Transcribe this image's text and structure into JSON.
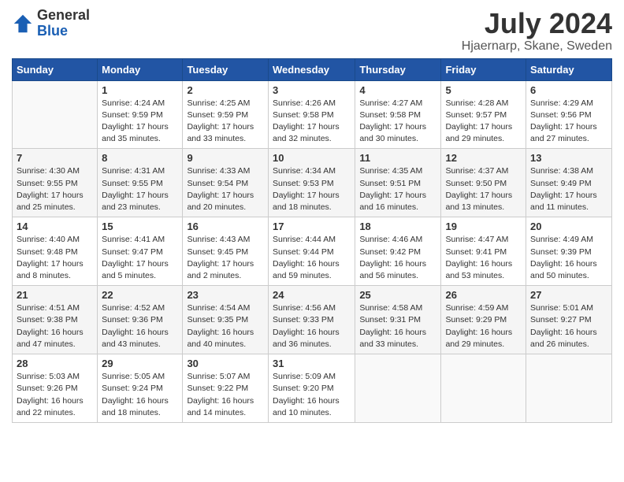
{
  "header": {
    "logo_line1": "General",
    "logo_line2": "Blue",
    "month": "July 2024",
    "location": "Hjaernarp, Skane, Sweden"
  },
  "days_of_week": [
    "Sunday",
    "Monday",
    "Tuesday",
    "Wednesday",
    "Thursday",
    "Friday",
    "Saturday"
  ],
  "weeks": [
    [
      {
        "day": "",
        "info": ""
      },
      {
        "day": "1",
        "info": "Sunrise: 4:24 AM\nSunset: 9:59 PM\nDaylight: 17 hours and 35 minutes."
      },
      {
        "day": "2",
        "info": "Sunrise: 4:25 AM\nSunset: 9:59 PM\nDaylight: 17 hours and 33 minutes."
      },
      {
        "day": "3",
        "info": "Sunrise: 4:26 AM\nSunset: 9:58 PM\nDaylight: 17 hours and 32 minutes."
      },
      {
        "day": "4",
        "info": "Sunrise: 4:27 AM\nSunset: 9:58 PM\nDaylight: 17 hours and 30 minutes."
      },
      {
        "day": "5",
        "info": "Sunrise: 4:28 AM\nSunset: 9:57 PM\nDaylight: 17 hours and 29 minutes."
      },
      {
        "day": "6",
        "info": "Sunrise: 4:29 AM\nSunset: 9:56 PM\nDaylight: 17 hours and 27 minutes."
      }
    ],
    [
      {
        "day": "7",
        "info": "Sunrise: 4:30 AM\nSunset: 9:55 PM\nDaylight: 17 hours and 25 minutes."
      },
      {
        "day": "8",
        "info": "Sunrise: 4:31 AM\nSunset: 9:55 PM\nDaylight: 17 hours and 23 minutes."
      },
      {
        "day": "9",
        "info": "Sunrise: 4:33 AM\nSunset: 9:54 PM\nDaylight: 17 hours and 20 minutes."
      },
      {
        "day": "10",
        "info": "Sunrise: 4:34 AM\nSunset: 9:53 PM\nDaylight: 17 hours and 18 minutes."
      },
      {
        "day": "11",
        "info": "Sunrise: 4:35 AM\nSunset: 9:51 PM\nDaylight: 17 hours and 16 minutes."
      },
      {
        "day": "12",
        "info": "Sunrise: 4:37 AM\nSunset: 9:50 PM\nDaylight: 17 hours and 13 minutes."
      },
      {
        "day": "13",
        "info": "Sunrise: 4:38 AM\nSunset: 9:49 PM\nDaylight: 17 hours and 11 minutes."
      }
    ],
    [
      {
        "day": "14",
        "info": "Sunrise: 4:40 AM\nSunset: 9:48 PM\nDaylight: 17 hours and 8 minutes."
      },
      {
        "day": "15",
        "info": "Sunrise: 4:41 AM\nSunset: 9:47 PM\nDaylight: 17 hours and 5 minutes."
      },
      {
        "day": "16",
        "info": "Sunrise: 4:43 AM\nSunset: 9:45 PM\nDaylight: 17 hours and 2 minutes."
      },
      {
        "day": "17",
        "info": "Sunrise: 4:44 AM\nSunset: 9:44 PM\nDaylight: 16 hours and 59 minutes."
      },
      {
        "day": "18",
        "info": "Sunrise: 4:46 AM\nSunset: 9:42 PM\nDaylight: 16 hours and 56 minutes."
      },
      {
        "day": "19",
        "info": "Sunrise: 4:47 AM\nSunset: 9:41 PM\nDaylight: 16 hours and 53 minutes."
      },
      {
        "day": "20",
        "info": "Sunrise: 4:49 AM\nSunset: 9:39 PM\nDaylight: 16 hours and 50 minutes."
      }
    ],
    [
      {
        "day": "21",
        "info": "Sunrise: 4:51 AM\nSunset: 9:38 PM\nDaylight: 16 hours and 47 minutes."
      },
      {
        "day": "22",
        "info": "Sunrise: 4:52 AM\nSunset: 9:36 PM\nDaylight: 16 hours and 43 minutes."
      },
      {
        "day": "23",
        "info": "Sunrise: 4:54 AM\nSunset: 9:35 PM\nDaylight: 16 hours and 40 minutes."
      },
      {
        "day": "24",
        "info": "Sunrise: 4:56 AM\nSunset: 9:33 PM\nDaylight: 16 hours and 36 minutes."
      },
      {
        "day": "25",
        "info": "Sunrise: 4:58 AM\nSunset: 9:31 PM\nDaylight: 16 hours and 33 minutes."
      },
      {
        "day": "26",
        "info": "Sunrise: 4:59 AM\nSunset: 9:29 PM\nDaylight: 16 hours and 29 minutes."
      },
      {
        "day": "27",
        "info": "Sunrise: 5:01 AM\nSunset: 9:27 PM\nDaylight: 16 hours and 26 minutes."
      }
    ],
    [
      {
        "day": "28",
        "info": "Sunrise: 5:03 AM\nSunset: 9:26 PM\nDaylight: 16 hours and 22 minutes."
      },
      {
        "day": "29",
        "info": "Sunrise: 5:05 AM\nSunset: 9:24 PM\nDaylight: 16 hours and 18 minutes."
      },
      {
        "day": "30",
        "info": "Sunrise: 5:07 AM\nSunset: 9:22 PM\nDaylight: 16 hours and 14 minutes."
      },
      {
        "day": "31",
        "info": "Sunrise: 5:09 AM\nSunset: 9:20 PM\nDaylight: 16 hours and 10 minutes."
      },
      {
        "day": "",
        "info": ""
      },
      {
        "day": "",
        "info": ""
      },
      {
        "day": "",
        "info": ""
      }
    ]
  ]
}
